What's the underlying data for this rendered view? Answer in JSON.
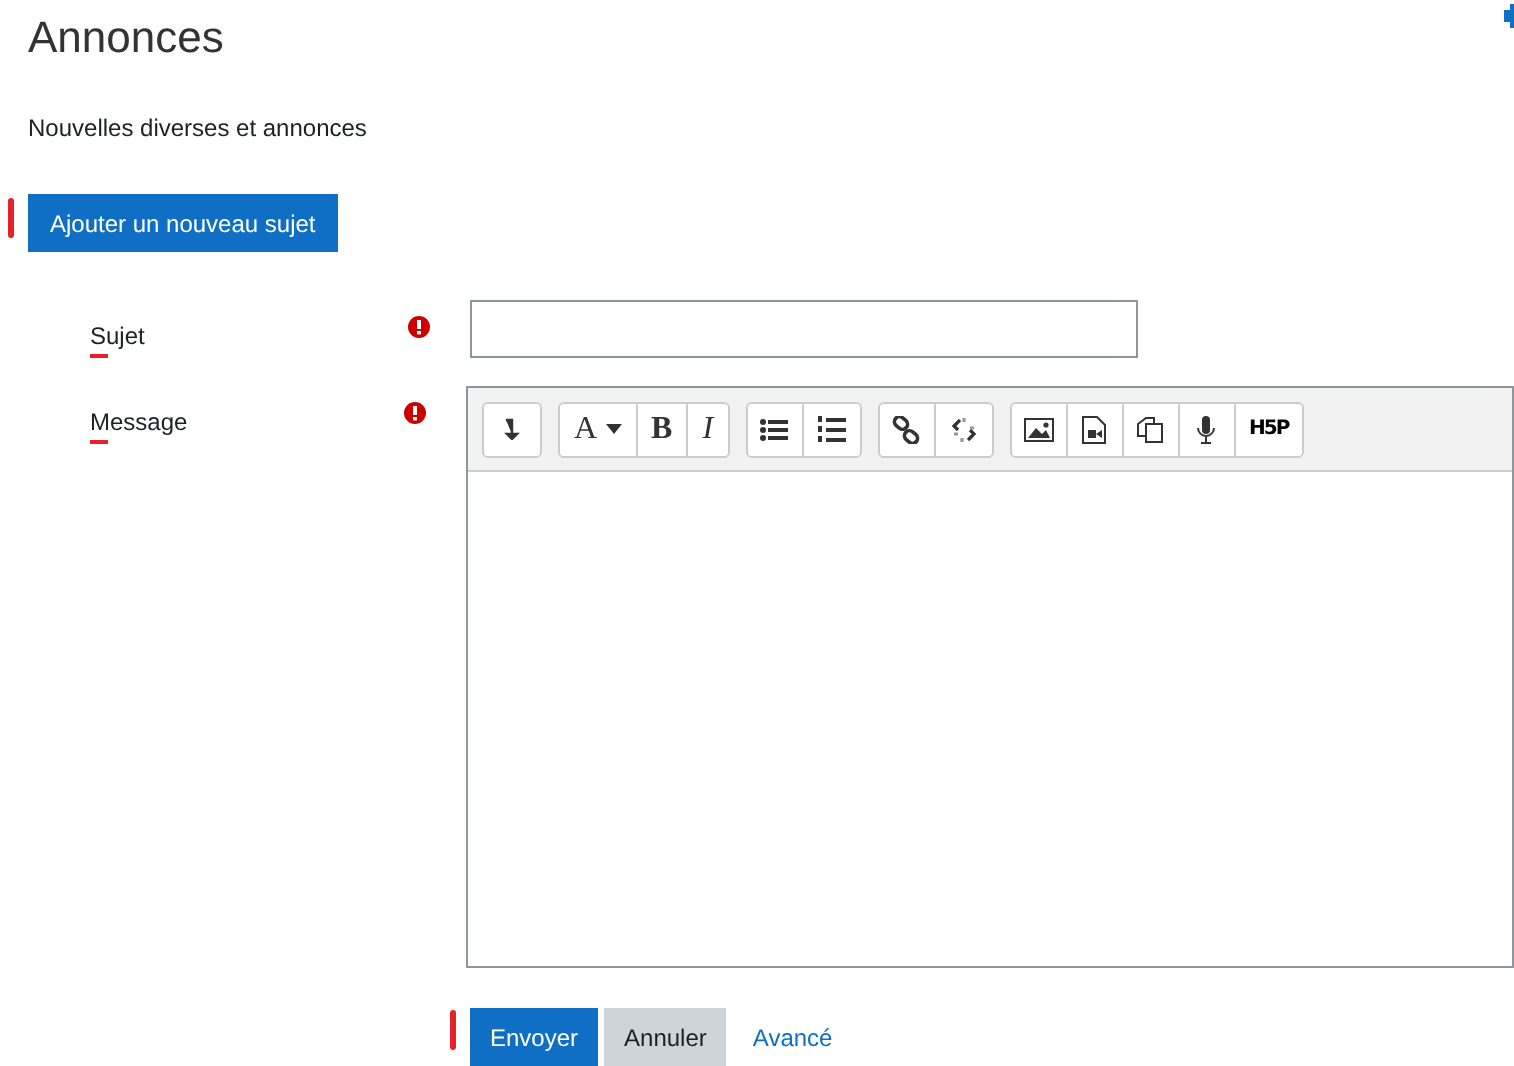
{
  "page": {
    "title": "Annonces",
    "subtitle": "Nouvelles diverses et annonces"
  },
  "add_button": {
    "label": "Ajouter un nouveau sujet",
    "marked": true
  },
  "fields": [
    {
      "label": "Sujet",
      "required": true,
      "marked": true,
      "kind": "input"
    },
    {
      "label": "Message",
      "required": true,
      "marked": true,
      "kind": "editor"
    }
  ],
  "toolbar": [
    [
      {
        "kind": "collapse"
      }
    ],
    [
      {
        "kind": "font",
        "label": "A"
      },
      {
        "kind": "bold",
        "label": "B"
      },
      {
        "kind": "italic",
        "label": "I"
      }
    ],
    [
      {
        "kind": "bullets"
      },
      {
        "kind": "numbers"
      }
    ],
    [
      {
        "kind": "link"
      },
      {
        "kind": "unlink"
      }
    ],
    [
      {
        "kind": "image"
      },
      {
        "kind": "media"
      },
      {
        "kind": "copy"
      },
      {
        "kind": "mic"
      },
      {
        "kind": "h5p",
        "label": "H5P"
      }
    ]
  ],
  "actions": [
    {
      "label": "Envoyer",
      "kind": "primary",
      "marked": true
    },
    {
      "label": "Annuler",
      "kind": "secondary",
      "marked": false
    },
    {
      "label": "Avancé",
      "kind": "link",
      "marked": false
    }
  ]
}
